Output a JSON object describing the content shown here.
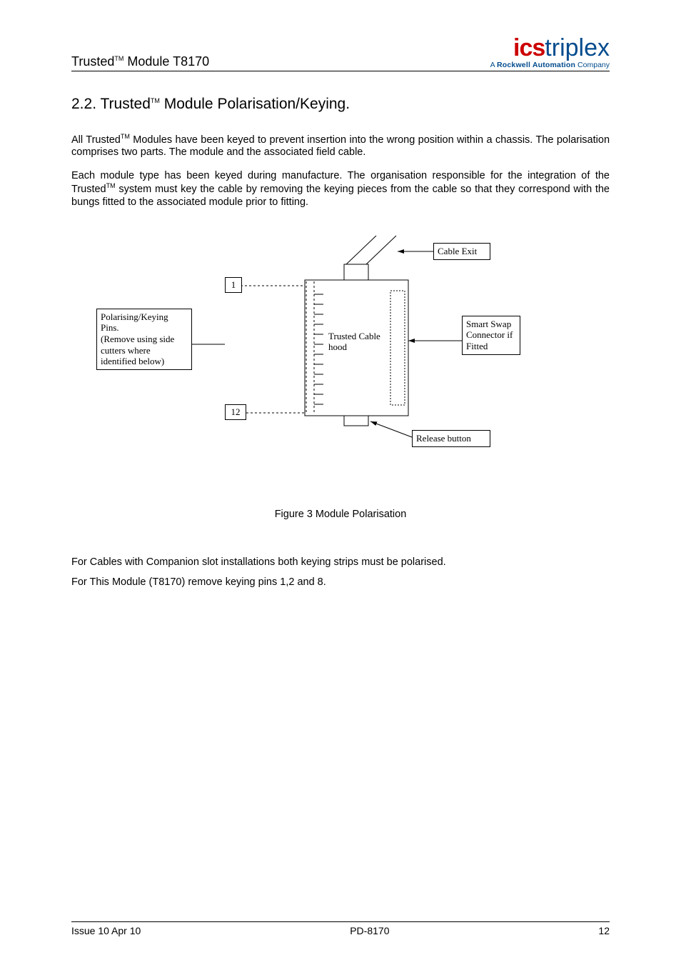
{
  "header": {
    "product_left": "Trusted",
    "tm": "TM",
    "product_model": "  Module T8170",
    "logo_ics": "ics",
    "logo_triplex": "triplex",
    "logo_sub_prefix": "A ",
    "logo_sub_bold": "Rockwell Automation",
    "logo_sub_suffix": " Company"
  },
  "section": {
    "number": "2.2. ",
    "title_pre": "Trusted",
    "title_tm": "TM",
    "title_post": " Module Polarisation/Keying."
  },
  "paragraphs": {
    "p1_pre": "All Trusted",
    "p1_tm": "TM",
    "p1_post": " Modules have been keyed to prevent insertion into the wrong position within a chassis. The polarisation comprises two parts.  The module and the associated field cable.",
    "p2_pre": "Each module type has been keyed during manufacture. The organisation responsible for the integration of the Trusted",
    "p2_tm": "TM",
    "p2_post": " system must key the cable by removing the keying pieces from the cable so that they correspond with the bungs fitted to the associated module prior to fitting.",
    "p3": "For Cables with Companion slot installations both keying strips must be polarised.",
    "p4": "For This Module (T8170) remove keying pins 1,2 and 8."
  },
  "figure": {
    "caption": "Figure 3 Module Polarisation",
    "labels": {
      "pin_top": "1",
      "pin_bottom": "12",
      "polarising": "Polarising/Keying Pins.\n(Remove using side cutters where identified below)",
      "hood": "Trusted Cable hood",
      "cable_exit": "Cable Exit",
      "smart_swap": "Smart Swap Connector if Fitted",
      "release": "Release button"
    }
  },
  "footer": {
    "left": "Issue 10 Apr 10",
    "center": "PD-8170",
    "right": "12"
  }
}
